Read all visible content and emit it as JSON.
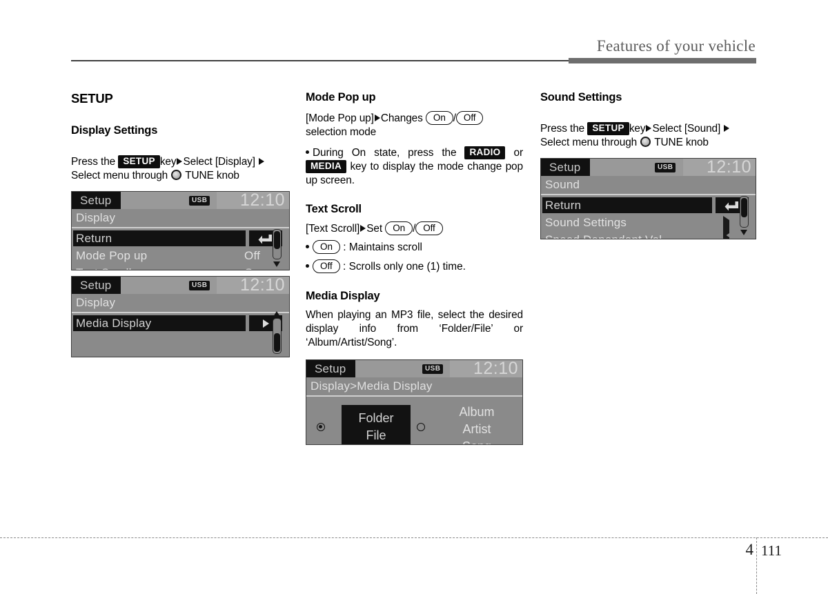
{
  "header": {
    "title": "Features of your vehicle"
  },
  "footer": {
    "chapter": "4",
    "page": "111"
  },
  "left_column": {
    "section_title": "SETUP",
    "subsection_title": "Display Settings",
    "instruction_part1": "Press the",
    "setup_key": "SETUP",
    "instruction_part2": "key",
    "instruction_part3": "Select [Display]",
    "instruction_part4": "Select menu through",
    "instruction_part5": "TUNE knob",
    "screen1": {
      "tab": "Setup",
      "usb": "USB",
      "clock": "12:10",
      "path": "Display",
      "rows": [
        {
          "label": "Return",
          "value": "",
          "selected": true,
          "icon": "return-arrow"
        },
        {
          "label": "Mode Pop up",
          "value": "Off",
          "selected": false,
          "icon": ""
        },
        {
          "label": "Text Scroll",
          "value": "On",
          "selected": false,
          "icon": ""
        }
      ]
    },
    "screen2": {
      "tab": "Setup",
      "usb": "USB",
      "clock": "12:10",
      "path": "Display",
      "rows": [
        {
          "label": "Media Display",
          "value": "",
          "selected": true,
          "icon": "chevron-right"
        }
      ]
    }
  },
  "middle_column": {
    "mode_popup": {
      "title": "Mode Pop up",
      "line1_a": "[Mode  Pop  up]",
      "line1_b": "Changes",
      "option_on": "On",
      "option_off": "Off",
      "line2": "selection mode",
      "bullet_a": "During On state, press the",
      "radio_key": "RADIO",
      "bullet_b": "or",
      "media_key": "MEDIA",
      "bullet_c": "key  to  display  the  mode change pop up screen."
    },
    "text_scroll": {
      "title": "Text Scroll",
      "line1_a": "[Text Scroll]",
      "line1_b": "Set",
      "option_on": "On",
      "option_off": "Off",
      "bullet1_pill": "On",
      "bullet1_text": ": Maintains scroll",
      "bullet2_pill": "Off",
      "bullet2_text": ": Scrolls only one (1) time."
    },
    "media_display": {
      "title": "Media Display",
      "body": "When  playing  an  MP3  file,  select  the desired  display  info  from  ‘Folder/File’  or ‘Album/Artist/Song’.",
      "screen": {
        "tab": "Setup",
        "usb": "USB",
        "clock": "12:10",
        "path": "Display>Media Display",
        "option_selected": "Folder\nFile",
        "option_selected_line1": "Folder",
        "option_selected_line2": "File",
        "option_other_line1": "Album",
        "option_other_line2": "Artist",
        "option_other_line3": "Song"
      }
    }
  },
  "right_column": {
    "section_title": "Sound Settings",
    "instruction_part1": "Press the",
    "setup_key": "SETUP",
    "instruction_part2": "key",
    "instruction_part3": "Select [Sound]",
    "instruction_part4": "Select menu through",
    "instruction_part5": "TUNE knob",
    "screen": {
      "tab": "Setup",
      "usb": "USB",
      "clock": "12:10",
      "path": "Sound",
      "rows": [
        {
          "label": "Return",
          "value": "",
          "selected": true,
          "icon": "return-arrow"
        },
        {
          "label": "Sound Settings",
          "value": "",
          "selected": false,
          "icon": "chevron-right"
        },
        {
          "label": "Speed Dependant Vol.",
          "value": "",
          "selected": false,
          "icon": "chevron-right"
        }
      ]
    }
  }
}
